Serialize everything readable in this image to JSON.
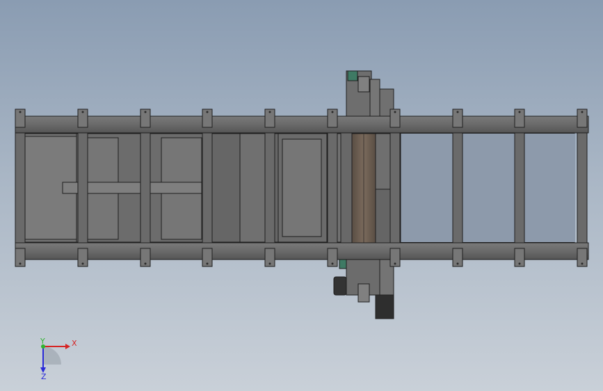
{
  "viewport": {
    "background_top": "#8a9cb2",
    "background_bottom": "#c9d0d8"
  },
  "model": {
    "frame_color": "#6e6e6e",
    "frame_dark": "#4a4a4a",
    "edge_color": "#1e1e1e",
    "belt_color": "#6b5e52",
    "accent_green": "#3e7a64"
  },
  "triad": {
    "x_label": "X",
    "y_label": "Y",
    "z_label": "Z",
    "x_color": "#d62424",
    "y_color": "#2fb52f",
    "z_color": "#2a2ad8"
  }
}
